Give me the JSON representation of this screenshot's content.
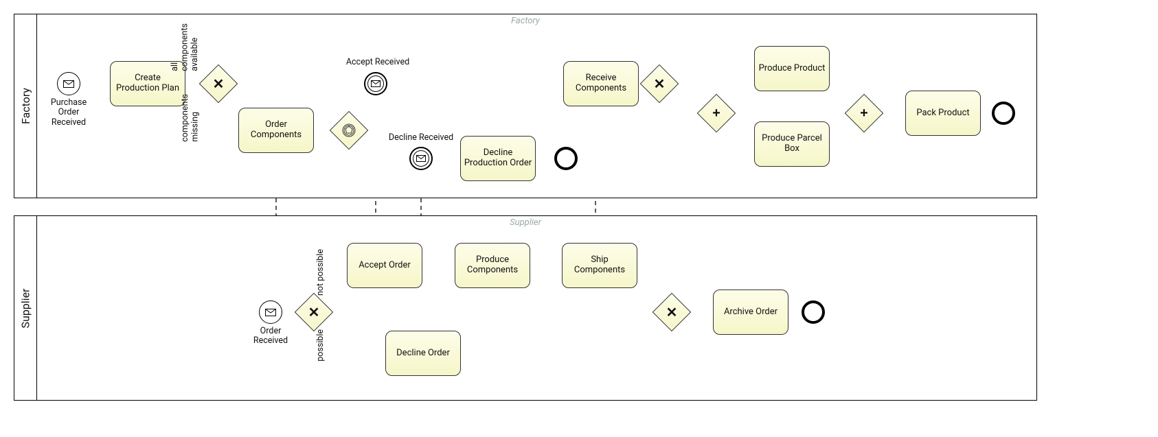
{
  "pools": {
    "factory": {
      "title": "Factory",
      "watermark": "Factory"
    },
    "supplier": {
      "title": "Supplier",
      "watermark": "Supplier"
    }
  },
  "factory": {
    "start_label": "Purchase\nOrder\nReceived",
    "create_plan": "Create Production Plan",
    "gw1_top": "all\ncomponents\navailable",
    "gw1_bottom": "components\nmissing",
    "order_components": "Order Components",
    "accept_received": "Accept Received",
    "decline_received": "Decline Received",
    "decline_production_order": "Decline Production Order",
    "receive_components": "Receive Components",
    "produce_product": "Produce Product",
    "produce_parcel_box": "Produce Parcel Box",
    "pack_product": "Pack Product"
  },
  "supplier": {
    "start_label": "Order\nReceived",
    "gw_top": "not possible",
    "gw_bottom": "possible",
    "accept_order": "Accept Order",
    "decline_order": "Decline Order",
    "produce_components": "Produce Components",
    "ship_components": "Ship Components",
    "archive_order": "Archive Order"
  }
}
